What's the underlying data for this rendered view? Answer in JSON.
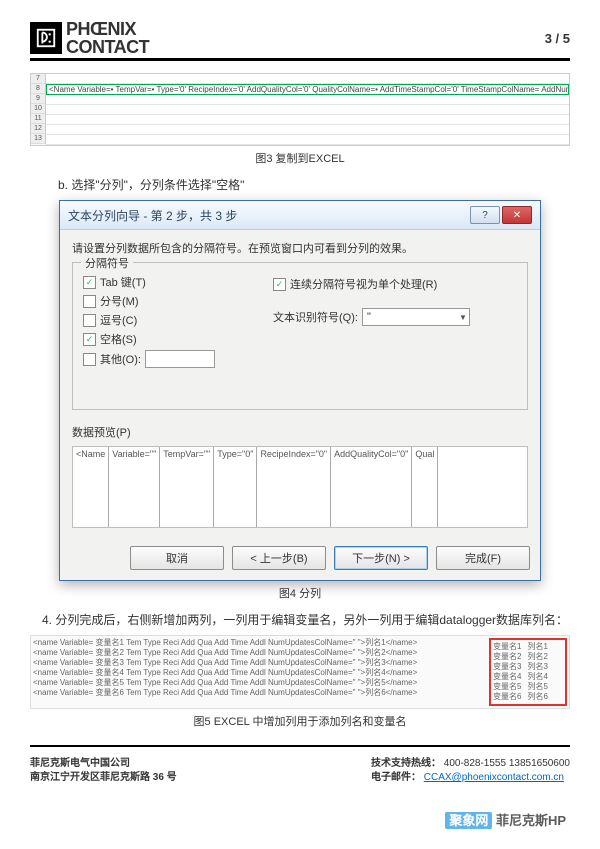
{
  "header": {
    "brand_line1": "PHŒNIX",
    "brand_line2": "CONTACT",
    "page_indicator": "3 / 5"
  },
  "fig3": {
    "row_numbers": [
      "7",
      "8",
      "9",
      "10",
      "11",
      "12",
      "13"
    ],
    "selected_row_text": "<Name Variable=•  TempVar=•  Type='0' RecipeIndex='0' AddQualityCol='0' QualityColName=•  AddTimeStampCol='0' TimeStampColName=   AddNum",
    "caption": "图3 复制到EXCEL"
  },
  "text_b": "b. 选择\"分列\"，分列条件选择\"空格\"",
  "dialog": {
    "title": "文本分列向导 - 第 2 步，共 3 步",
    "help_icon": "?",
    "close_icon": "✕",
    "instruction": "请设置分列数据所包含的分隔符号。在预览窗口内可看到分列的效果。",
    "group_delimiters": "分隔符号",
    "options": {
      "tab": {
        "label": "Tab 键(T)",
        "checked": true
      },
      "semi": {
        "label": "分号(M)",
        "checked": false
      },
      "comma": {
        "label": "逗号(C)",
        "checked": false
      },
      "space": {
        "label": "空格(S)",
        "checked": true
      },
      "other": {
        "label": "其他(O):",
        "checked": false,
        "value": ""
      }
    },
    "treat_consecutive": {
      "label": "连续分隔符号视为单个处理(R)",
      "checked": true
    },
    "text_qualifier_label": "文本识别符号(Q):",
    "text_qualifier_value": "\"",
    "preview_label": "数据预览(P)",
    "preview_columns": [
      "<Name",
      "Variable=\"\"",
      "TempVar=\"\"",
      "Type=\"0\"",
      "RecipeIndex=\"0\"",
      "AddQualityCol=\"0\"",
      "Qual"
    ],
    "buttons": {
      "cancel": "取消",
      "back": "< 上一步(B)",
      "next": "下一步(N) >",
      "finish": "完成(F)"
    }
  },
  "fig4_caption": "图4 分列",
  "step4": "4.   分列完成后，右侧新增加两列，一列用于编辑变量名，另外一列用于编辑datalogger数据库列名：",
  "fig5": {
    "rows": [
      "<name  Variable= 变量名1  Tem Type Reci Add Qua Add Time Addl NumUpdatesColName=\" \">列名1</name>",
      "<name  Variable= 变量名2  Tem Type Reci Add Qua Add Time Addl NumUpdatesColName=\" \">列名2</name>",
      "<name  Variable= 变量名3  Tem Type Reci Add Qua Add Time Addl NumUpdatesColName=\" \">列名3</name>",
      "<name  Variable= 变量名4  Tem Type Reci Add Qua Add Time Addl NumUpdatesColName=\" \">列名4</name>",
      "<name  Variable= 变量名5  Tem Type Reci Add Qua Add Time Addl NumUpdatesColName=\" \">列名5</name>",
      "<name  Variable= 变量名6  Tem Type Reci Add Qua Add Time Addl NumUpdatesColName=\" \">列名6</name>"
    ],
    "right_pairs": [
      [
        "变量名1",
        "列名1"
      ],
      [
        "变量名2",
        "列名2"
      ],
      [
        "变量名3",
        "列名3"
      ],
      [
        "变量名4",
        "列名4"
      ],
      [
        "变量名5",
        "列名5"
      ],
      [
        "变量名6",
        "列名6"
      ]
    ],
    "caption": "图5  EXCEL 中增加列用于添加列名和变量名"
  },
  "footer": {
    "left_line1": "菲尼克斯电气中国公司",
    "left_line2": "南京江宁开发区菲尼克斯路 36 号",
    "right_hotline_label": "技术支持热线：",
    "right_hotline_value": "400-828-1555   13851650600",
    "right_email_label": "电子邮件：",
    "right_email_value": "CCAX@phoenixcontact.com.cn"
  },
  "watermark": {
    "site": "聚象网",
    "tail": " 菲尼克斯HP"
  }
}
